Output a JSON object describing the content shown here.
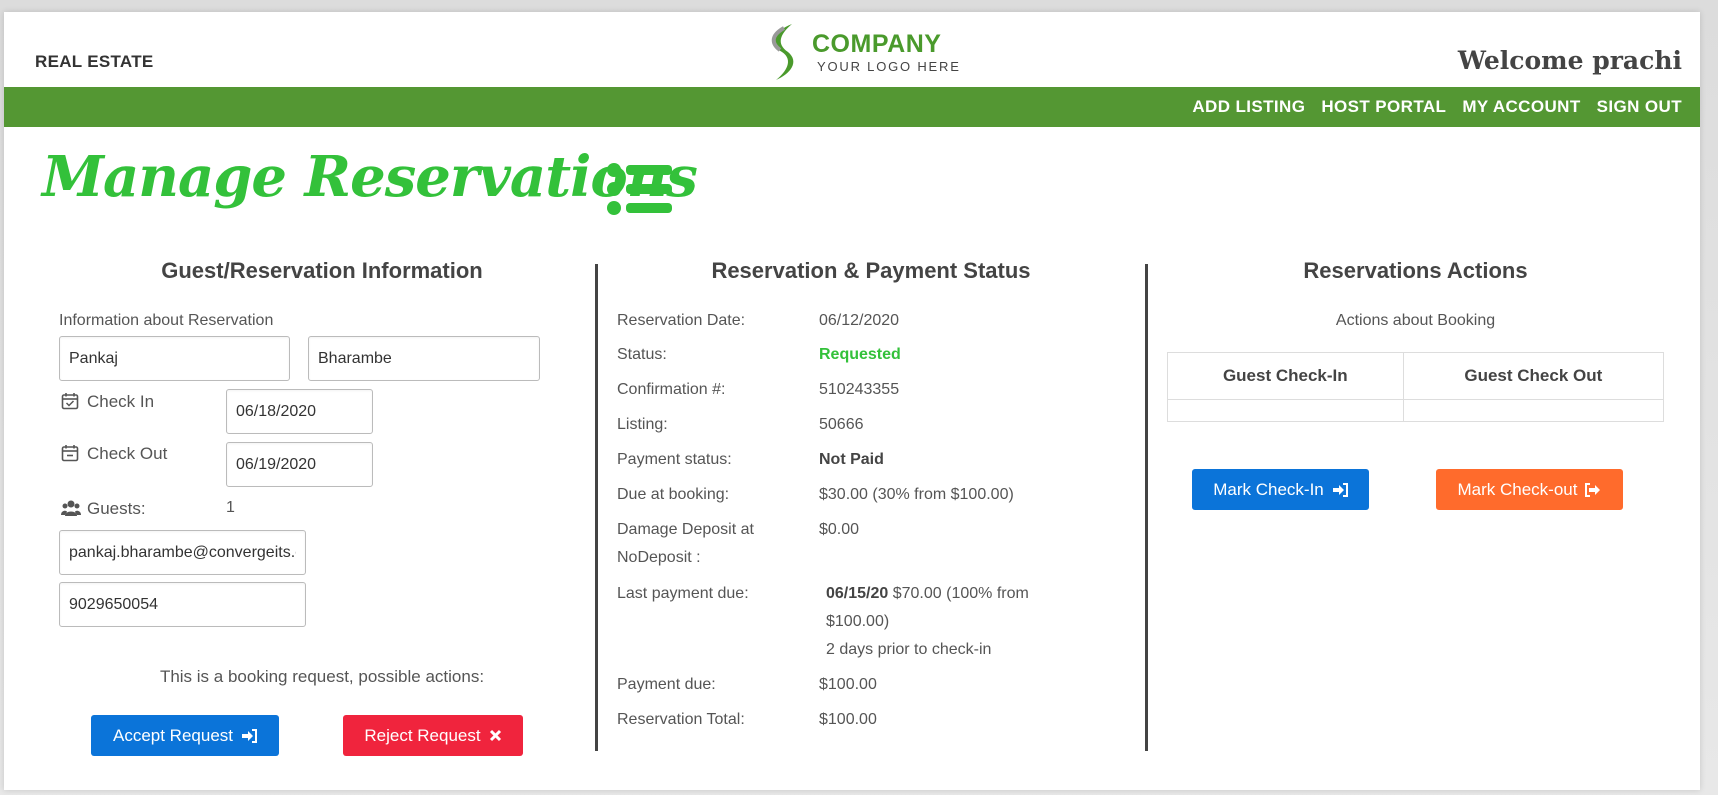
{
  "header": {
    "brand": "REAL ESTATE",
    "logo_title": "COMPANY",
    "logo_subtitle": "YOUR LOGO HERE",
    "welcome": "Welcome prachi"
  },
  "nav": {
    "items": [
      {
        "label": "ADD LISTING"
      },
      {
        "label": "HOST PORTAL"
      },
      {
        "label": "MY ACCOUNT"
      },
      {
        "label": "SIGN OUT"
      }
    ]
  },
  "page": {
    "title": "Manage Reservations"
  },
  "guest": {
    "title": "Guest/Reservation Information",
    "info_label": "Information about Reservation",
    "first_name": "Pankaj",
    "last_name": "Bharambe",
    "check_in_label": "Check In",
    "check_in": "06/18/2020",
    "check_out_label": "Check Out",
    "check_out": "06/19/2020",
    "guests_label": "Guests:",
    "guests": "1",
    "email": "pankaj.bharambe@convergeits.com",
    "phone": "9029650054",
    "booking_note": "This is a booking request, possible actions:",
    "accept_label": "Accept Request",
    "reject_label": "Reject Request"
  },
  "status": {
    "title": "Reservation & Payment Status",
    "rows": [
      {
        "label": "Reservation Date:",
        "value": "06/12/2020"
      },
      {
        "label": "Status:",
        "value": "Requested"
      },
      {
        "label": "Confirmation #:",
        "value": "510243355"
      },
      {
        "label": "Listing:",
        "value": "50666"
      },
      {
        "label": "Payment status:",
        "value": "Not Paid"
      },
      {
        "label": "Due at booking:",
        "value": "$30.00 (30% from $100.00)"
      },
      {
        "label": "Damage Deposit at",
        "value": "$0.00"
      },
      {
        "label": "NoDeposit :",
        "value": ""
      },
      {
        "label": "Last payment due:",
        "value": "$70.00 (100% from"
      },
      {
        "label": "",
        "value": "$100.00)"
      },
      {
        "label": "",
        "value": "2 days prior to check-in"
      },
      {
        "label": "Payment due:",
        "value": "$100.00"
      },
      {
        "label": "Reservation Total:",
        "value": "$100.00"
      }
    ],
    "last_payment_date": "06/15/20",
    "status_color": "#33c13a"
  },
  "actions": {
    "title": "Reservations Actions",
    "subtitle": "Actions about Booking",
    "col1": "Guest Check-In",
    "col2": "Guest Check Out",
    "checkin_label": "Mark Check-In",
    "checkout_label": "Mark Check-out"
  },
  "colors": {
    "nav_green": "#549733",
    "title_green": "#33c13a",
    "blue": "#0b74d9",
    "red": "#f0243d",
    "orange": "#ff6b2c"
  }
}
